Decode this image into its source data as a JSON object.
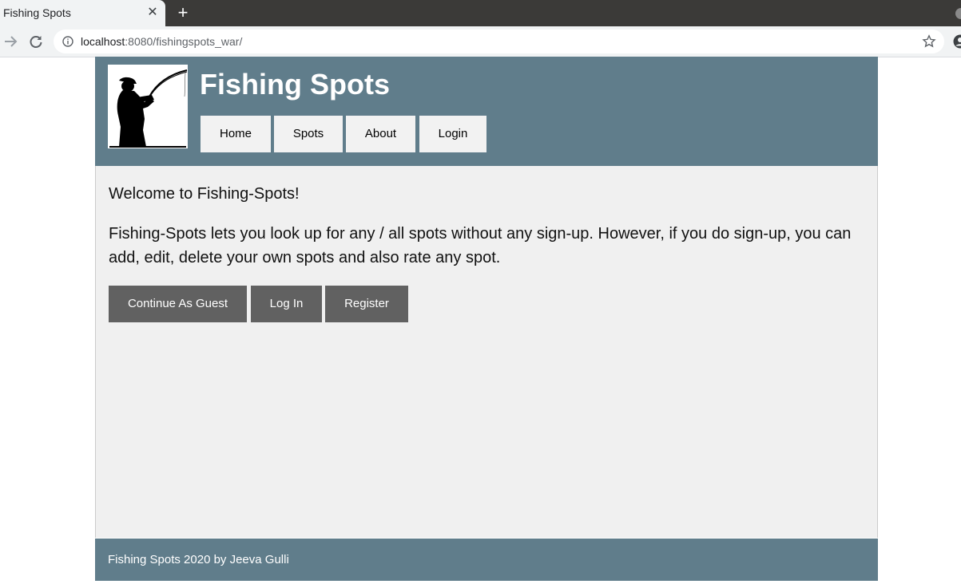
{
  "browser": {
    "tab_title": "Fishing Spots",
    "tab_close_glyph": "✕",
    "new_tab_glyph": "+",
    "url_host": "localhost",
    "url_rest": ":8080/fishingspots_war/"
  },
  "header": {
    "title": "Fishing Spots",
    "nav": [
      {
        "label": "Home"
      },
      {
        "label": "Spots"
      },
      {
        "label": "About"
      },
      {
        "label": "Login"
      }
    ]
  },
  "main": {
    "welcome": "Welcome to Fishing-Spots!",
    "description": "Fishing-Spots lets you look up for any / all spots without any sign-up. However, if you do sign-up, you can add, edit, delete your own spots and also rate any spot.",
    "buttons": [
      {
        "label": "Continue As Guest"
      },
      {
        "label": "Log In"
      },
      {
        "label": "Register"
      }
    ]
  },
  "footer": {
    "text": "Fishing Spots 2020 by Jeeva Gulli"
  },
  "colors": {
    "header_bg": "#607d8b",
    "content_bg": "#f0f0f0",
    "nav_bg": "#f2f2f2",
    "button_bg": "#616161"
  },
  "icons": {
    "back": "arrow-right-icon",
    "reload": "reload-icon",
    "site_info": "info-icon",
    "bookmark": "star-icon",
    "account": "account-icon",
    "logo": "fisherman-silhouette"
  }
}
